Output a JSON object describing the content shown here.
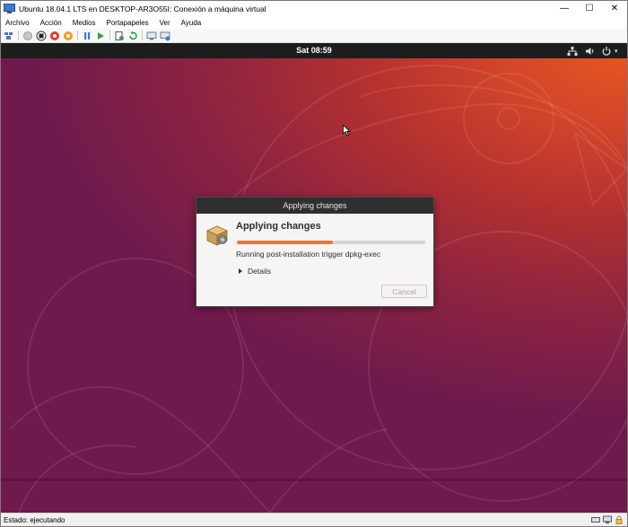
{
  "window": {
    "title": "Ubuntu 18.04.1 LTS en DESKTOP-AR3O55I: Conexión a máquina virtual",
    "minimize_glyph": "—",
    "maximize_glyph": "☐",
    "close_glyph": "✕"
  },
  "menubar": {
    "items": [
      "Archivo",
      "Acción",
      "Medios",
      "Portapapeles",
      "Ver",
      "Ayuda"
    ]
  },
  "toolbar": {
    "icons": [
      "ctrl-alt-del-icon",
      "start-icon",
      "turn-off-icon",
      "shutdown-icon",
      "save-icon",
      "pause-icon",
      "resume-icon",
      "checkpoint-icon",
      "revert-icon",
      "enhanced-session-icon",
      "share-icon"
    ]
  },
  "desktop": {
    "clock": "Sat 08:59",
    "tray_icons": [
      "network-icon",
      "volume-icon",
      "power-icon"
    ],
    "accent_color": "#e9733f"
  },
  "dialog": {
    "window_title": "Applying changes",
    "heading": "Applying changes",
    "progress_fraction": 0.51,
    "status": "Running post-installation trigger dpkg-exec",
    "details_label": "Details",
    "cancel_label": "Cancel"
  },
  "statusbar": {
    "text": "Estado: ejecutando",
    "icons": [
      "keyboard-icon",
      "monitor-icon",
      "lock-icon"
    ]
  }
}
